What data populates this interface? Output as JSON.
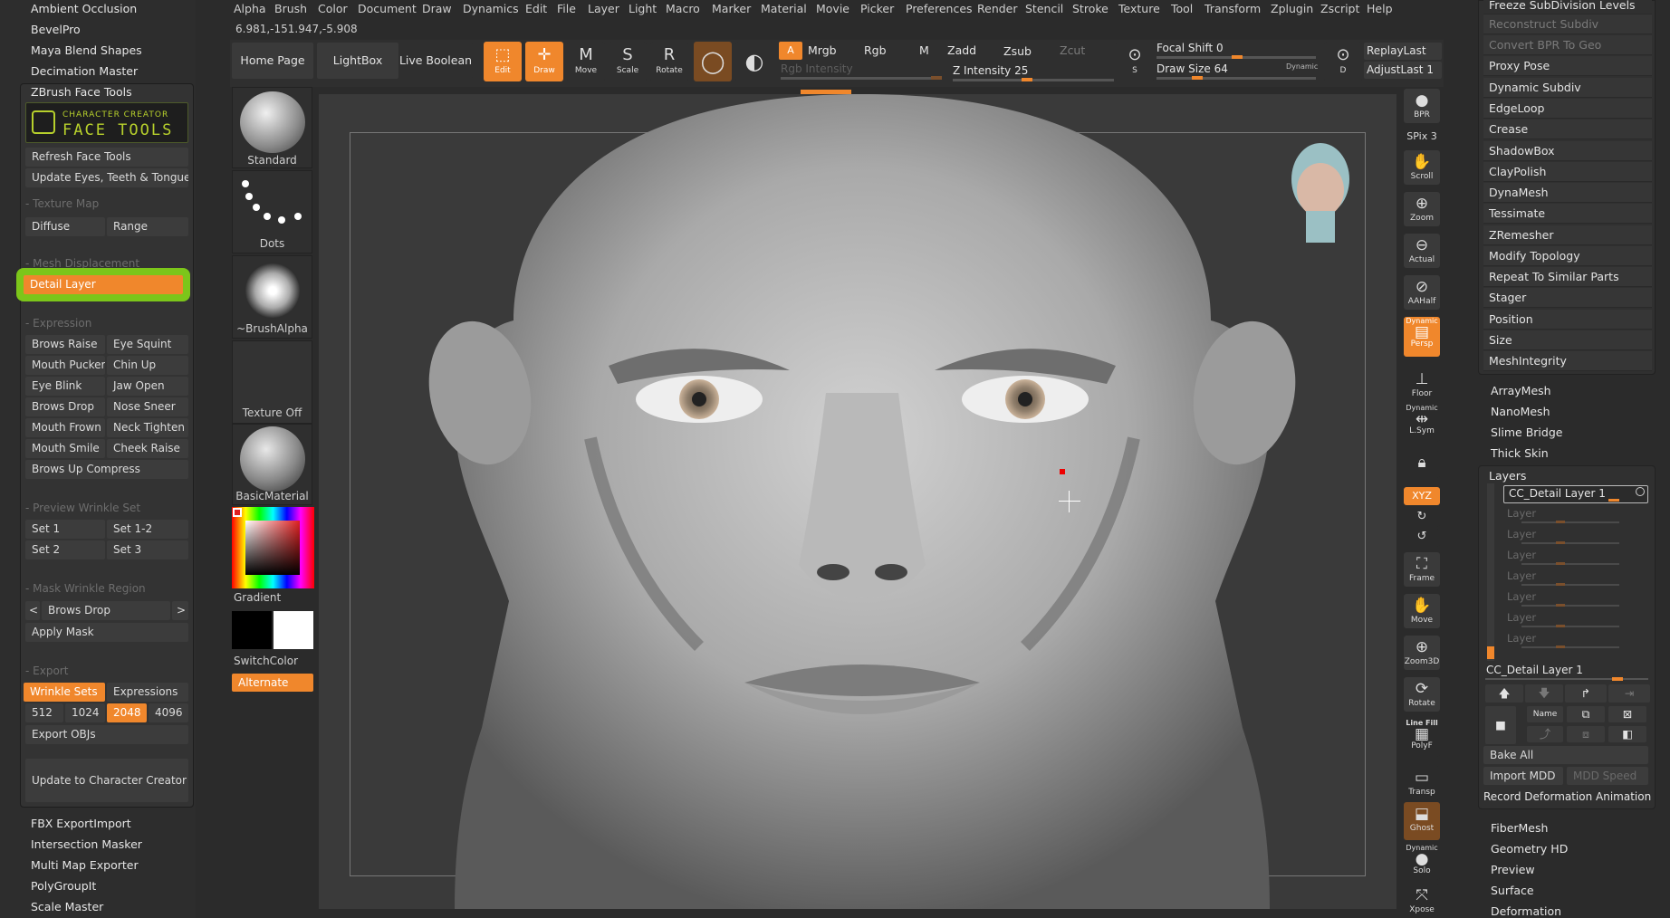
{
  "menu": [
    "Alpha",
    "Brush",
    "Color",
    "Document",
    "Draw",
    "Dynamics",
    "Edit",
    "File",
    "Layer",
    "Light",
    "Macro",
    "Marker",
    "Material",
    "Movie",
    "Picker",
    "Preferences",
    "Render",
    "Stencil",
    "Stroke",
    "Texture",
    "Tool",
    "Transform",
    "Zplugin",
    "Zscript",
    "Help"
  ],
  "coords": "6.981,-151.947,-5.908",
  "left_plugins_top": [
    "Ambient Occlusion",
    "BevelPro",
    "Maya Blend Shapes",
    "Decimation Master"
  ],
  "face_tools": {
    "title": "ZBrush Face Tools",
    "logo_line1": "CHARACTER CREATOR",
    "logo_line2": "FACE TOOLS",
    "refresh": "Refresh Face Tools",
    "update_eyes": "Update Eyes, Teeth & Tongue",
    "texture_map": "Texture Map",
    "diffuse": "Diffuse",
    "range": "Range",
    "mesh_displacement": "Mesh Displacement",
    "detail_layer": "Detail Layer",
    "expression": "Expression",
    "expr_left": [
      "Brows Raise",
      "Mouth Pucker",
      "Eye Blink",
      "Brows Drop",
      "Mouth Frown",
      "Mouth Smile",
      "Brows Up Compress"
    ],
    "expr_right": [
      "Eye Squint",
      "Chin Up",
      "Jaw Open",
      "Nose Sneer",
      "Neck Tighten",
      "Cheek Raise"
    ],
    "preview_wrinkle": "Preview Wrinkle Set",
    "sets": [
      "Set 1",
      "Set 1-2",
      "Set 2",
      "Set 3"
    ],
    "mask_region": "Mask Wrinkle Region",
    "mask_prev": "<",
    "mask_next": ">",
    "mask_value": "Brows Drop",
    "apply_mask": "Apply Mask",
    "export": "Export",
    "wrinkle_sets": "Wrinkle Sets",
    "expressions": "Expressions",
    "sizes": [
      "512",
      "1024",
      "2048",
      "4096"
    ],
    "export_objs": "Export OBJs",
    "update_cc": "Update to Character Creator"
  },
  "left_plugins_bottom": [
    "FBX ExportImport",
    "Intersection Masker",
    "Multi Map Exporter",
    "PolyGroupIt",
    "Scale Master"
  ],
  "toolbar": {
    "home": "Home Page",
    "lightbox": "LightBox",
    "live_boolean": "Live Boolean",
    "edit": "Edit",
    "draw": "Draw",
    "move": "Move",
    "scale": "Scale",
    "rotate": "Rotate",
    "a": "A",
    "mrgb": "Mrgb",
    "rgb": "Rgb",
    "m": "M",
    "zadd": "Zadd",
    "zsub": "Zsub",
    "zcut": "Zcut",
    "rgb_intensity": "Rgb Intensity",
    "z_intensity": "Z Intensity 25",
    "focal": "Focal Shift 0",
    "drawsize": "Draw Size 64",
    "dynamic": "Dynamic",
    "replay": "ReplayLast",
    "adjust": "AdjustLast 1",
    "s": "S",
    "d": "D"
  },
  "brushes": {
    "standard": "Standard",
    "dots": "Dots",
    "alpha": "~BrushAlpha",
    "texture": "Texture Off",
    "material": "BasicMaterial",
    "gradient": "Gradient",
    "switch": "SwitchColor",
    "alternate": "Alternate"
  },
  "right_icons": [
    "BPR",
    "SPix 3",
    "Scroll",
    "Zoom",
    "Actual",
    "AAHalf",
    "Persp",
    "Floor",
    "L.Sym",
    "XYZ",
    "Frame",
    "Move",
    "Zoom3D",
    "Rotate",
    "PolyF",
    "Transp",
    "Ghost",
    "Solo",
    "Xpose"
  ],
  "right_icon_extra": {
    "dynamic": "Dynamic",
    "linefill": "Line Fill"
  },
  "right_top": [
    "Freeze SubDivision Levels",
    "Reconstruct Subdiv",
    "Convert BPR To Geo",
    "Proxy Pose",
    "Dynamic Subdiv",
    "EdgeLoop",
    "Crease",
    "ShadowBox",
    "ClayPolish",
    "DynaMesh",
    "Tessimate",
    "ZRemesher",
    "Modify Topology",
    "Repeat To Similar Parts",
    "Stager",
    "Position",
    "Size",
    "MeshIntegrity"
  ],
  "right_mid": [
    "ArrayMesh",
    "NanoMesh",
    "Slime Bridge",
    "Thick Skin"
  ],
  "layers": {
    "title": "Layers",
    "active": "CC_Detail Layer 1",
    "empty": "Layer",
    "current": "CC_Detail Layer 1",
    "name": "Name",
    "bake": "Bake All",
    "import_mdd": "Import MDD",
    "mdd_speed": "MDD Speed",
    "record": "Record Deformation Animation"
  },
  "right_bottom": [
    "FiberMesh",
    "Geometry HD",
    "Preview",
    "Surface",
    "Deformation"
  ]
}
